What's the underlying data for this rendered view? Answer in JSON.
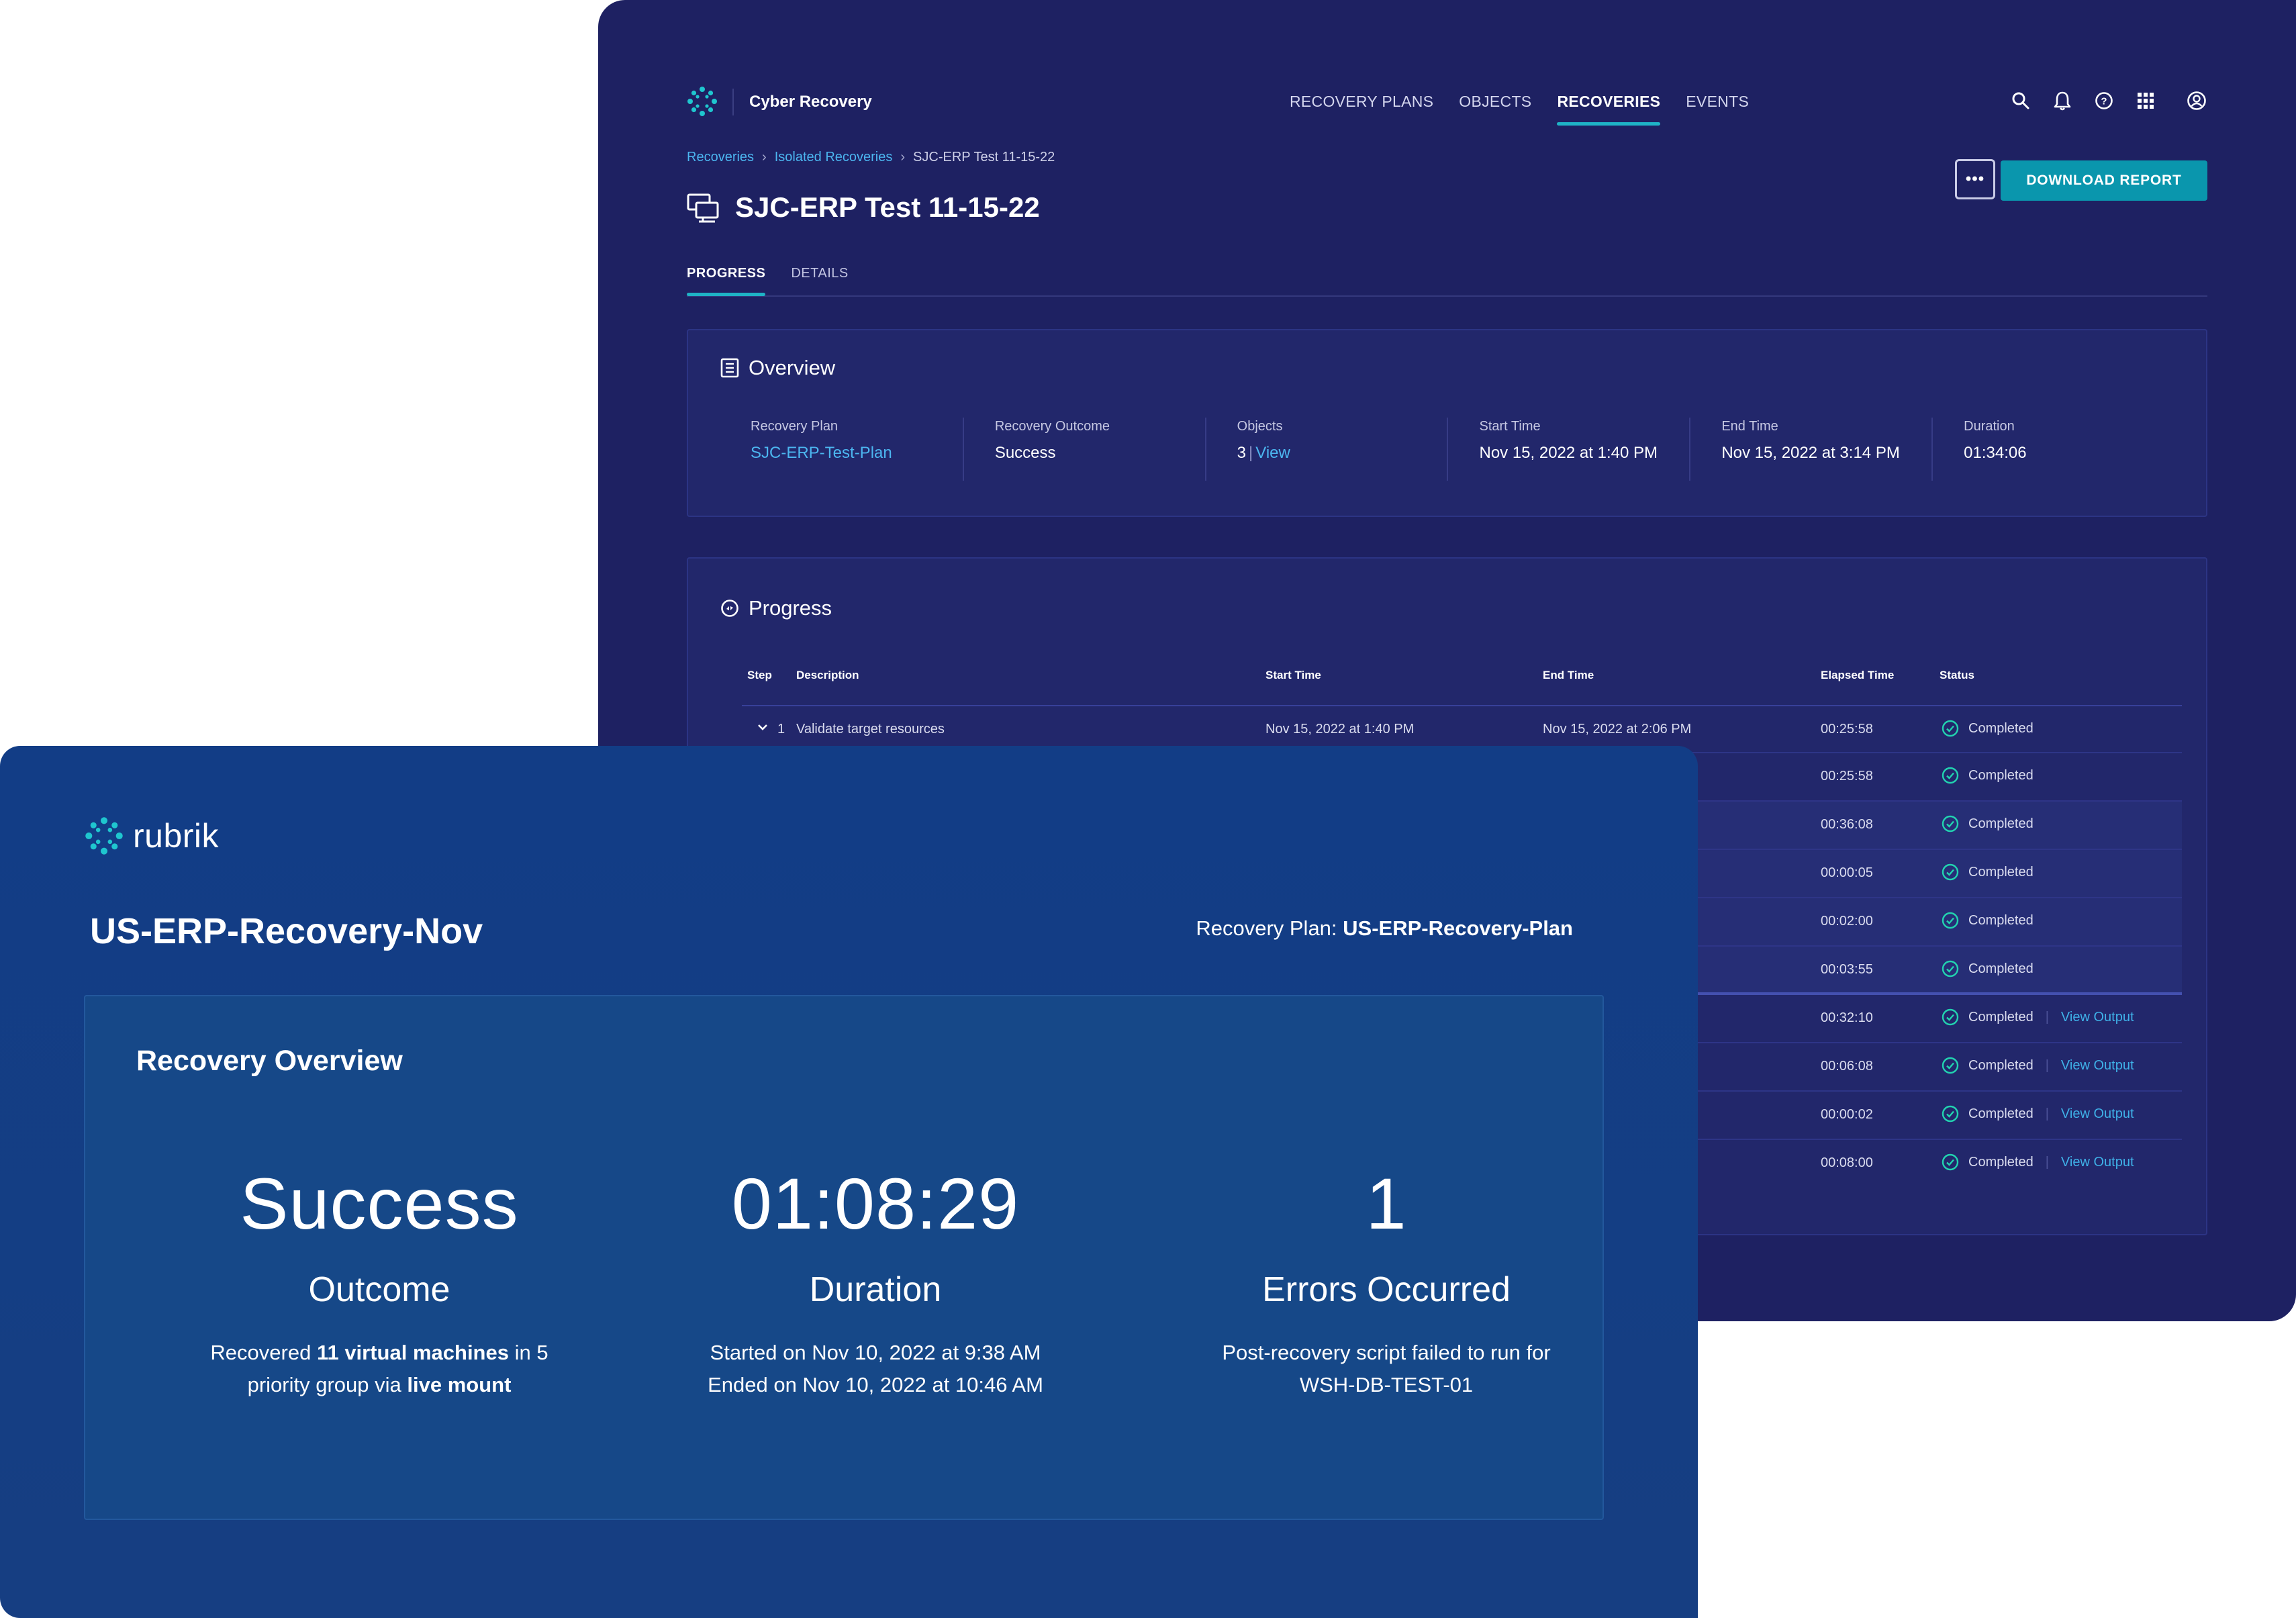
{
  "app": {
    "title": "Cyber Recovery",
    "nav": [
      "RECOVERY PLANS",
      "OBJECTS",
      "RECOVERIES",
      "EVENTS"
    ],
    "active_nav": "RECOVERIES",
    "icons": [
      "search-icon",
      "bell-icon",
      "help-icon",
      "apps-grid-icon",
      "account-icon"
    ],
    "accent_color": "#1fb3c6",
    "button_color": "#0a96ad",
    "link_color": "#4cb6f0"
  },
  "breadcrumb": {
    "items": [
      "Recoveries",
      "Isolated Recoveries"
    ],
    "current": "SJC-ERP Test 11-15-22"
  },
  "page": {
    "title": "SJC-ERP Test 11-15-22",
    "more_label": "•••",
    "download_label": "DOWNLOAD REPORT",
    "tabs": [
      "PROGRESS",
      "DETAILS"
    ],
    "active_tab": "PROGRESS"
  },
  "overview": {
    "title": "Overview",
    "fields": [
      {
        "label": "Recovery Plan",
        "value": "SJC-ERP-Test-Plan"
      },
      {
        "label": "Recovery Outcome",
        "value": "Success"
      },
      {
        "label": "Objects",
        "value": "3",
        "link": "View"
      },
      {
        "label": "Start Time",
        "value": "Nov 15, 2022 at 1:40 PM"
      },
      {
        "label": "End Time",
        "value": "Nov 15, 2022 at 3:14 PM"
      },
      {
        "label": "Duration",
        "value": "01:34:06"
      }
    ]
  },
  "progress": {
    "title": "Progress",
    "columns": [
      "Step",
      "Description",
      "Start Time",
      "End Time",
      "Elapsed Time",
      "Status"
    ],
    "view_output_label": "View Output",
    "rows": [
      {
        "step": "1",
        "description": "Validate target resources",
        "start": "Nov 15, 2022 at 1:40 PM",
        "end": "Nov 15, 2022 at 2:06 PM",
        "elapsed": "00:25:58",
        "status": "Completed"
      },
      {
        "elapsed": "00:25:58",
        "status": "Completed"
      },
      {
        "elapsed": "00:36:08",
        "status": "Completed"
      },
      {
        "elapsed": "00:00:05",
        "status": "Completed"
      },
      {
        "elapsed": "00:02:00",
        "status": "Completed"
      },
      {
        "elapsed": "00:03:55",
        "status": "Completed"
      },
      {
        "elapsed": "00:32:10",
        "status": "Completed"
      },
      {
        "elapsed": "00:06:08",
        "status": "Completed"
      },
      {
        "elapsed": "00:00:02",
        "status": "Completed"
      },
      {
        "elapsed": "00:08:00",
        "status": "Completed"
      }
    ]
  },
  "report": {
    "logo_text": "rubrik",
    "title": "US-ERP-Recovery-Nov",
    "plan_label": "Recovery Plan: ",
    "plan_name": "US-ERP-Recovery-Plan",
    "section_title": "Recovery Overview",
    "stats": {
      "outcome": {
        "value": "Success",
        "label": "Outcome",
        "desc_1": "Recovered ",
        "desc_bold_1": "11 virtual machines",
        "desc_2": " in 5",
        "desc_3": "priority group via ",
        "desc_bold_2": "live mount"
      },
      "duration": {
        "value": "01:08:29",
        "label": "Duration",
        "line_1": "Started on Nov 10, 2022 at 9:38 AM",
        "line_2": "Ended on Nov 10, 2022 at 10:46 AM"
      },
      "errors": {
        "value": "1",
        "label": "Errors Occurred",
        "line_1": "Post-recovery script failed to run for",
        "line_2": "WSH-DB-TEST-01"
      }
    }
  }
}
